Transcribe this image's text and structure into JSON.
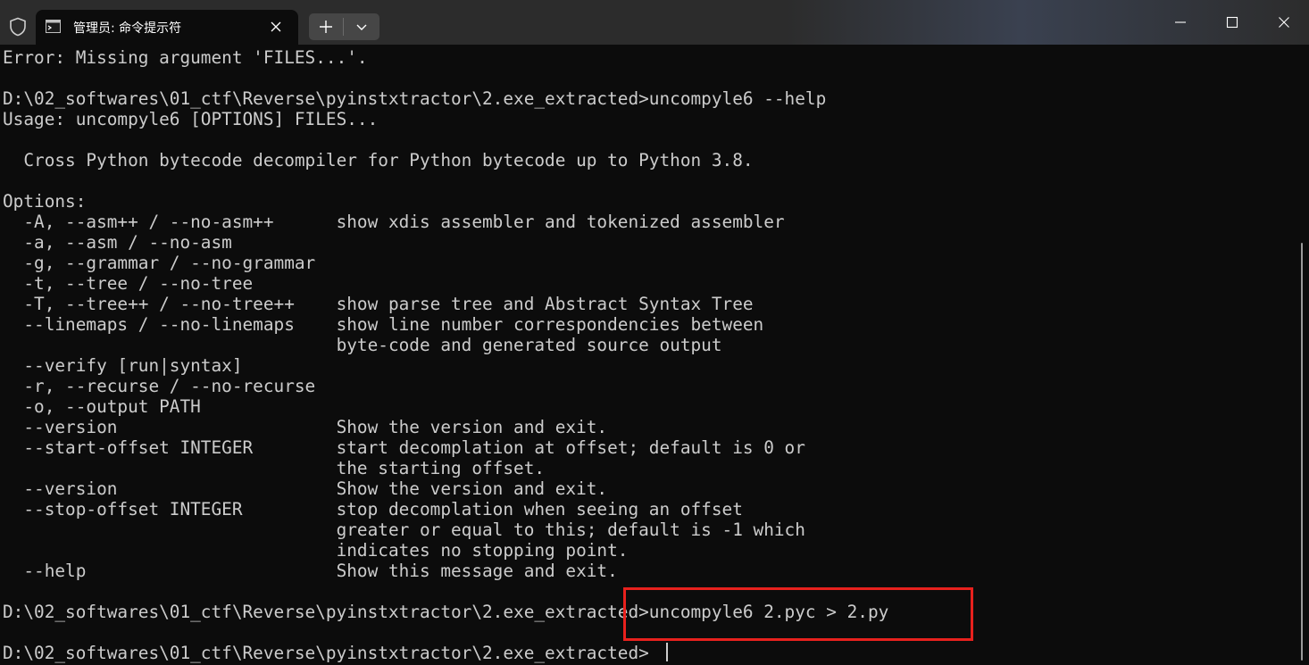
{
  "window": {
    "tab_title": "管理员: 命令提示符",
    "accent_color": "#e8211d"
  },
  "icons": {
    "shield": "shield-icon",
    "terminal": "terminal-icon",
    "close_tab": "close-icon",
    "new_tab": "plus-icon",
    "dropdown": "chevron-down-icon",
    "minimize": "minimize-icon",
    "maximize": "maximize-icon",
    "close_window": "close-icon"
  },
  "terminal": {
    "lines": [
      "Error: Missing argument 'FILES...'.",
      "",
      "D:\\02_softwares\\01_ctf\\Reverse\\pyinstxtractor\\2.exe_extracted>uncompyle6 --help",
      "Usage: uncompyle6 [OPTIONS] FILES...",
      "",
      "  Cross Python bytecode decompiler for Python bytecode up to Python 3.8.",
      "",
      "Options:",
      "  -A, --asm++ / --no-asm++      show xdis assembler and tokenized assembler",
      "  -a, --asm / --no-asm",
      "  -g, --grammar / --no-grammar",
      "  -t, --tree / --no-tree",
      "  -T, --tree++ / --no-tree++    show parse tree and Abstract Syntax Tree",
      "  --linemaps / --no-linemaps    show line number correspondencies between",
      "                                byte-code and generated source output",
      "  --verify [run|syntax]",
      "  -r, --recurse / --no-recurse",
      "  -o, --output PATH",
      "  --version                     Show the version and exit.",
      "  --start-offset INTEGER        start decomplation at offset; default is 0 or",
      "                                the starting offset.",
      "  --version                     Show the version and exit.",
      "  --stop-offset INTEGER         stop decomplation when seeing an offset",
      "                                greater or equal to this; default is -1 which",
      "                                indicates no stopping point.",
      "  --help                        Show this message and exit.",
      "",
      "D:\\02_softwares\\01_ctf\\Reverse\\pyinstxtractor\\2.exe_extracted>uncompyle6 2.pyc > 2.py",
      "",
      "D:\\02_softwares\\01_ctf\\Reverse\\pyinstxtractor\\2.exe_extracted>"
    ]
  }
}
